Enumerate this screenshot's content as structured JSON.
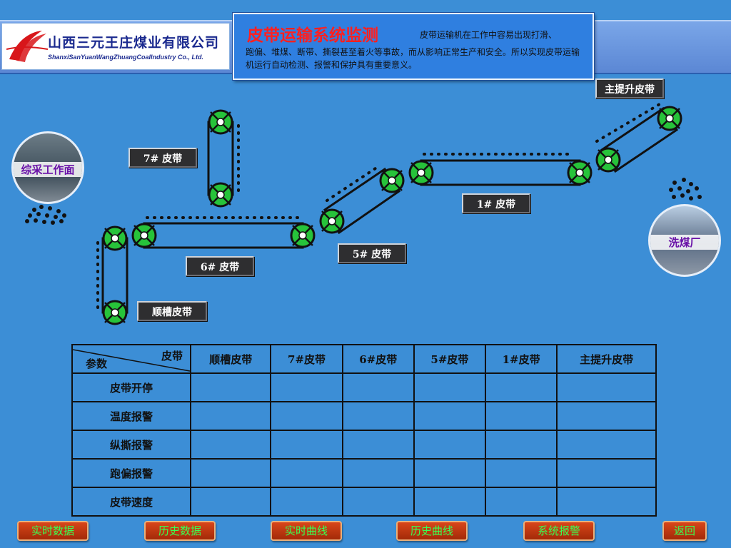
{
  "header": {
    "company_cn": "山西三元王庄煤业有限公司",
    "company_en": "ShanxiSanYuanWangZhuangCoalIndustry Co., Ltd.",
    "title": "皮带运输系统监测",
    "desc_line1": "皮带运输机在工作中容易出现打滑、",
    "desc_rest": "跑偏、堆煤、断带、撕裂甚至着火等事故，而从影响正常生产和安全。所以实现皮带运输机运行自动检测、报警和保护具有重要意义。"
  },
  "sites": {
    "face": "综采工作面",
    "plant": "洗煤厂"
  },
  "belt_labels": {
    "b7": "7# 皮带",
    "b6": "6# 皮带",
    "b5": "5# 皮带",
    "b1": "1# 皮带",
    "main": "主提升皮带",
    "chute": "顺槽皮带"
  },
  "table": {
    "corner_belt": "皮带",
    "corner_param": "参数",
    "columns": [
      "顺槽皮带",
      "7#皮带",
      "6#皮带",
      "5#皮带",
      "1#皮带",
      "主提升皮带"
    ],
    "rows": [
      "皮带开停",
      "温度报警",
      "纵撕报警",
      "跑偏报警",
      "皮带速度"
    ]
  },
  "buttons": {
    "realtime": "实时数据",
    "history": "历史数据",
    "rt_curve": "实时曲线",
    "hist_curve": "历史曲线",
    "alarm": "系统报警",
    "back": "返回"
  },
  "colors": {
    "background": "#3c8ed6",
    "title": "#ff2020",
    "button_text": "#39ff52",
    "pulley": "#27c33a"
  }
}
